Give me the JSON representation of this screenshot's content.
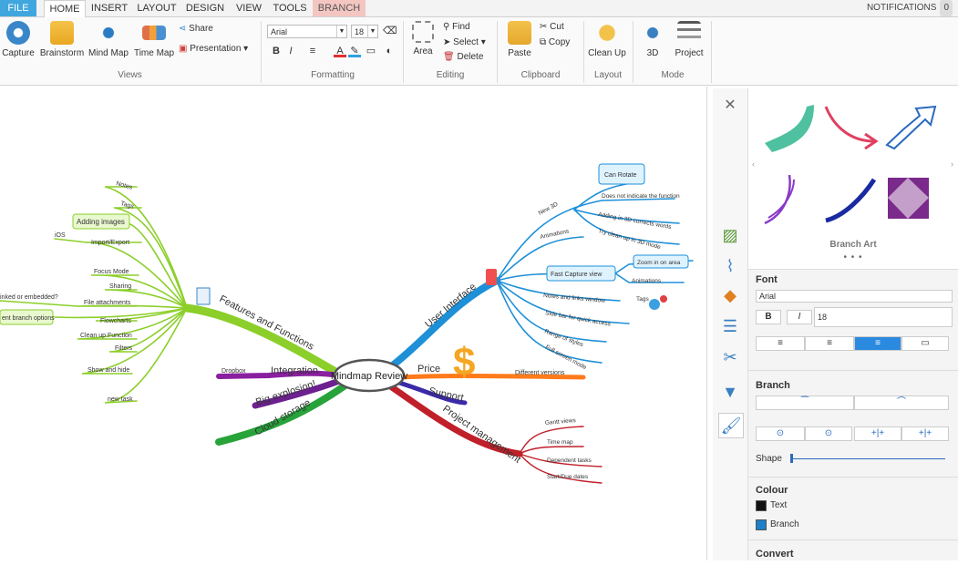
{
  "tabs": [
    {
      "label": "FILE"
    },
    {
      "label": "HOME"
    },
    {
      "label": "INSERT"
    },
    {
      "label": "LAYOUT"
    },
    {
      "label": "DESIGN"
    },
    {
      "label": "VIEW"
    },
    {
      "label": "TOOLS"
    },
    {
      "label": "BRANCH"
    }
  ],
  "notifications": {
    "label": "NOTIFICATIONS",
    "count": "0"
  },
  "ribbon": {
    "views": {
      "capture": "Capture",
      "brainstorm": "Brainstorm",
      "mindmap": "Mind Map",
      "timemap": "Time Map",
      "share": "Share",
      "presentation": "Presentation",
      "group": "Views"
    },
    "formatting": {
      "font": "Arial",
      "size": "18",
      "bold": "B",
      "italic": "I",
      "group": "Formatting"
    },
    "editing": {
      "area": "Area",
      "find": "Find",
      "select": "Select",
      "delete": "Delete",
      "group": "Editing"
    },
    "clipboard": {
      "paste": "Paste",
      "cut": "Cut",
      "copy": "Copy",
      "group": "Clipboard"
    },
    "layout": {
      "cleanup": "Clean Up",
      "group": "Layout"
    },
    "mode": {
      "threed": "3D",
      "project": "Project",
      "group": "Mode"
    }
  },
  "mindmap": {
    "center": "Mindmap Review",
    "features": {
      "label": "Features and Functions",
      "items": [
        "Notes",
        "Tags",
        "Adding images",
        "Import/Export",
        "iOS",
        "Focus Mode",
        "Sharing",
        "File attachments",
        "Flowcharts",
        "Clean up Function",
        "Filters",
        "Show and hide",
        "new task"
      ],
      "boxes": [
        "Adding images",
        "ent branch options"
      ],
      "linked": "inked or embedded?"
    },
    "ui": {
      "label": "User Interface",
      "items": [
        "New 3D",
        "Does not indicate the function",
        "Adding in 3D corrects words",
        "Try clean up in 3D mode",
        "Animations",
        "Fast Capture view",
        "Zoom in on area",
        "Animations",
        "Notes and links window",
        "Side bar for quick access",
        "Range of styles",
        "Full screen mode",
        "Tags"
      ],
      "box": "Can Rotate"
    },
    "price": {
      "label": "Price",
      "items": [
        "Different versions"
      ]
    },
    "support": {
      "label": "Support"
    },
    "project": {
      "label": "Project management",
      "items": [
        "Gantt views",
        "Time map",
        "Dependent tasks",
        "Start/Due dates"
      ]
    },
    "integration": {
      "label": "Integration",
      "items": [
        "Dropbox"
      ]
    },
    "big": {
      "label": "Big explosion!"
    },
    "cloud": {
      "label": "Cloud storage"
    }
  },
  "panel": {
    "branch_art": "Branch Art",
    "font_title": "Font",
    "font_name": "Arial",
    "font_size": "18",
    "bold": "B",
    "italic": "I",
    "branch_title": "Branch",
    "shape": "Shape",
    "colour_title": "Colour",
    "text": "Text",
    "branch": "Branch",
    "convert": "Convert"
  },
  "colors": {
    "features": "#8ccf2a",
    "ui": "#1e90d8",
    "price": "#ff7a1a",
    "support": "#3a2aa8",
    "project": "#c0202a",
    "integration": "#8a1fa0",
    "big": "#6d2090",
    "cloud": "#27a33a",
    "accent": "#3fa7de"
  }
}
